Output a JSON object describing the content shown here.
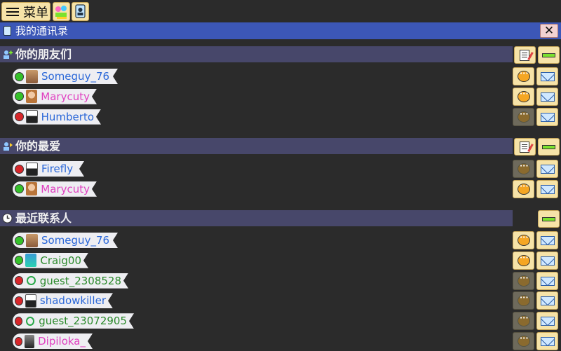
{
  "toolbar": {
    "menu_label": "菜单"
  },
  "window": {
    "title": "我的通讯录",
    "close_symbol": "✕"
  },
  "sections": {
    "friends": {
      "title": "你的朋友们",
      "contacts": [
        {
          "name": "Someguy_76",
          "status": "online",
          "color": "blue"
        },
        {
          "name": "Marycuty",
          "status": "online",
          "color": "pink"
        },
        {
          "name": "Humberto",
          "status": "offline",
          "color": "blue"
        }
      ]
    },
    "favorites": {
      "title": "你的最爱",
      "contacts": [
        {
          "name": "Firefly",
          "status": "offline",
          "color": "blue"
        },
        {
          "name": "Marycuty",
          "status": "online",
          "color": "pink"
        }
      ]
    },
    "recent": {
      "title": "最近联系人",
      "contacts": [
        {
          "name": "Someguy_76",
          "status": "online",
          "color": "blue"
        },
        {
          "name": "Craig00",
          "status": "online",
          "color": "green"
        },
        {
          "name": "guest_2308528",
          "status": "offline",
          "color": "green"
        },
        {
          "name": "shadowkiller",
          "status": "offline",
          "color": "blue"
        },
        {
          "name": "guest_23072905",
          "status": "offline",
          "color": "green"
        },
        {
          "name": "Dipiloka_",
          "status": "offline",
          "color": "pink"
        }
      ]
    }
  },
  "colors": {
    "title_bar": "#3c57b7",
    "section_bar": "#47476a",
    "button": "#f6e3a8",
    "online": "#35c12a",
    "offline": "#d8262a"
  }
}
